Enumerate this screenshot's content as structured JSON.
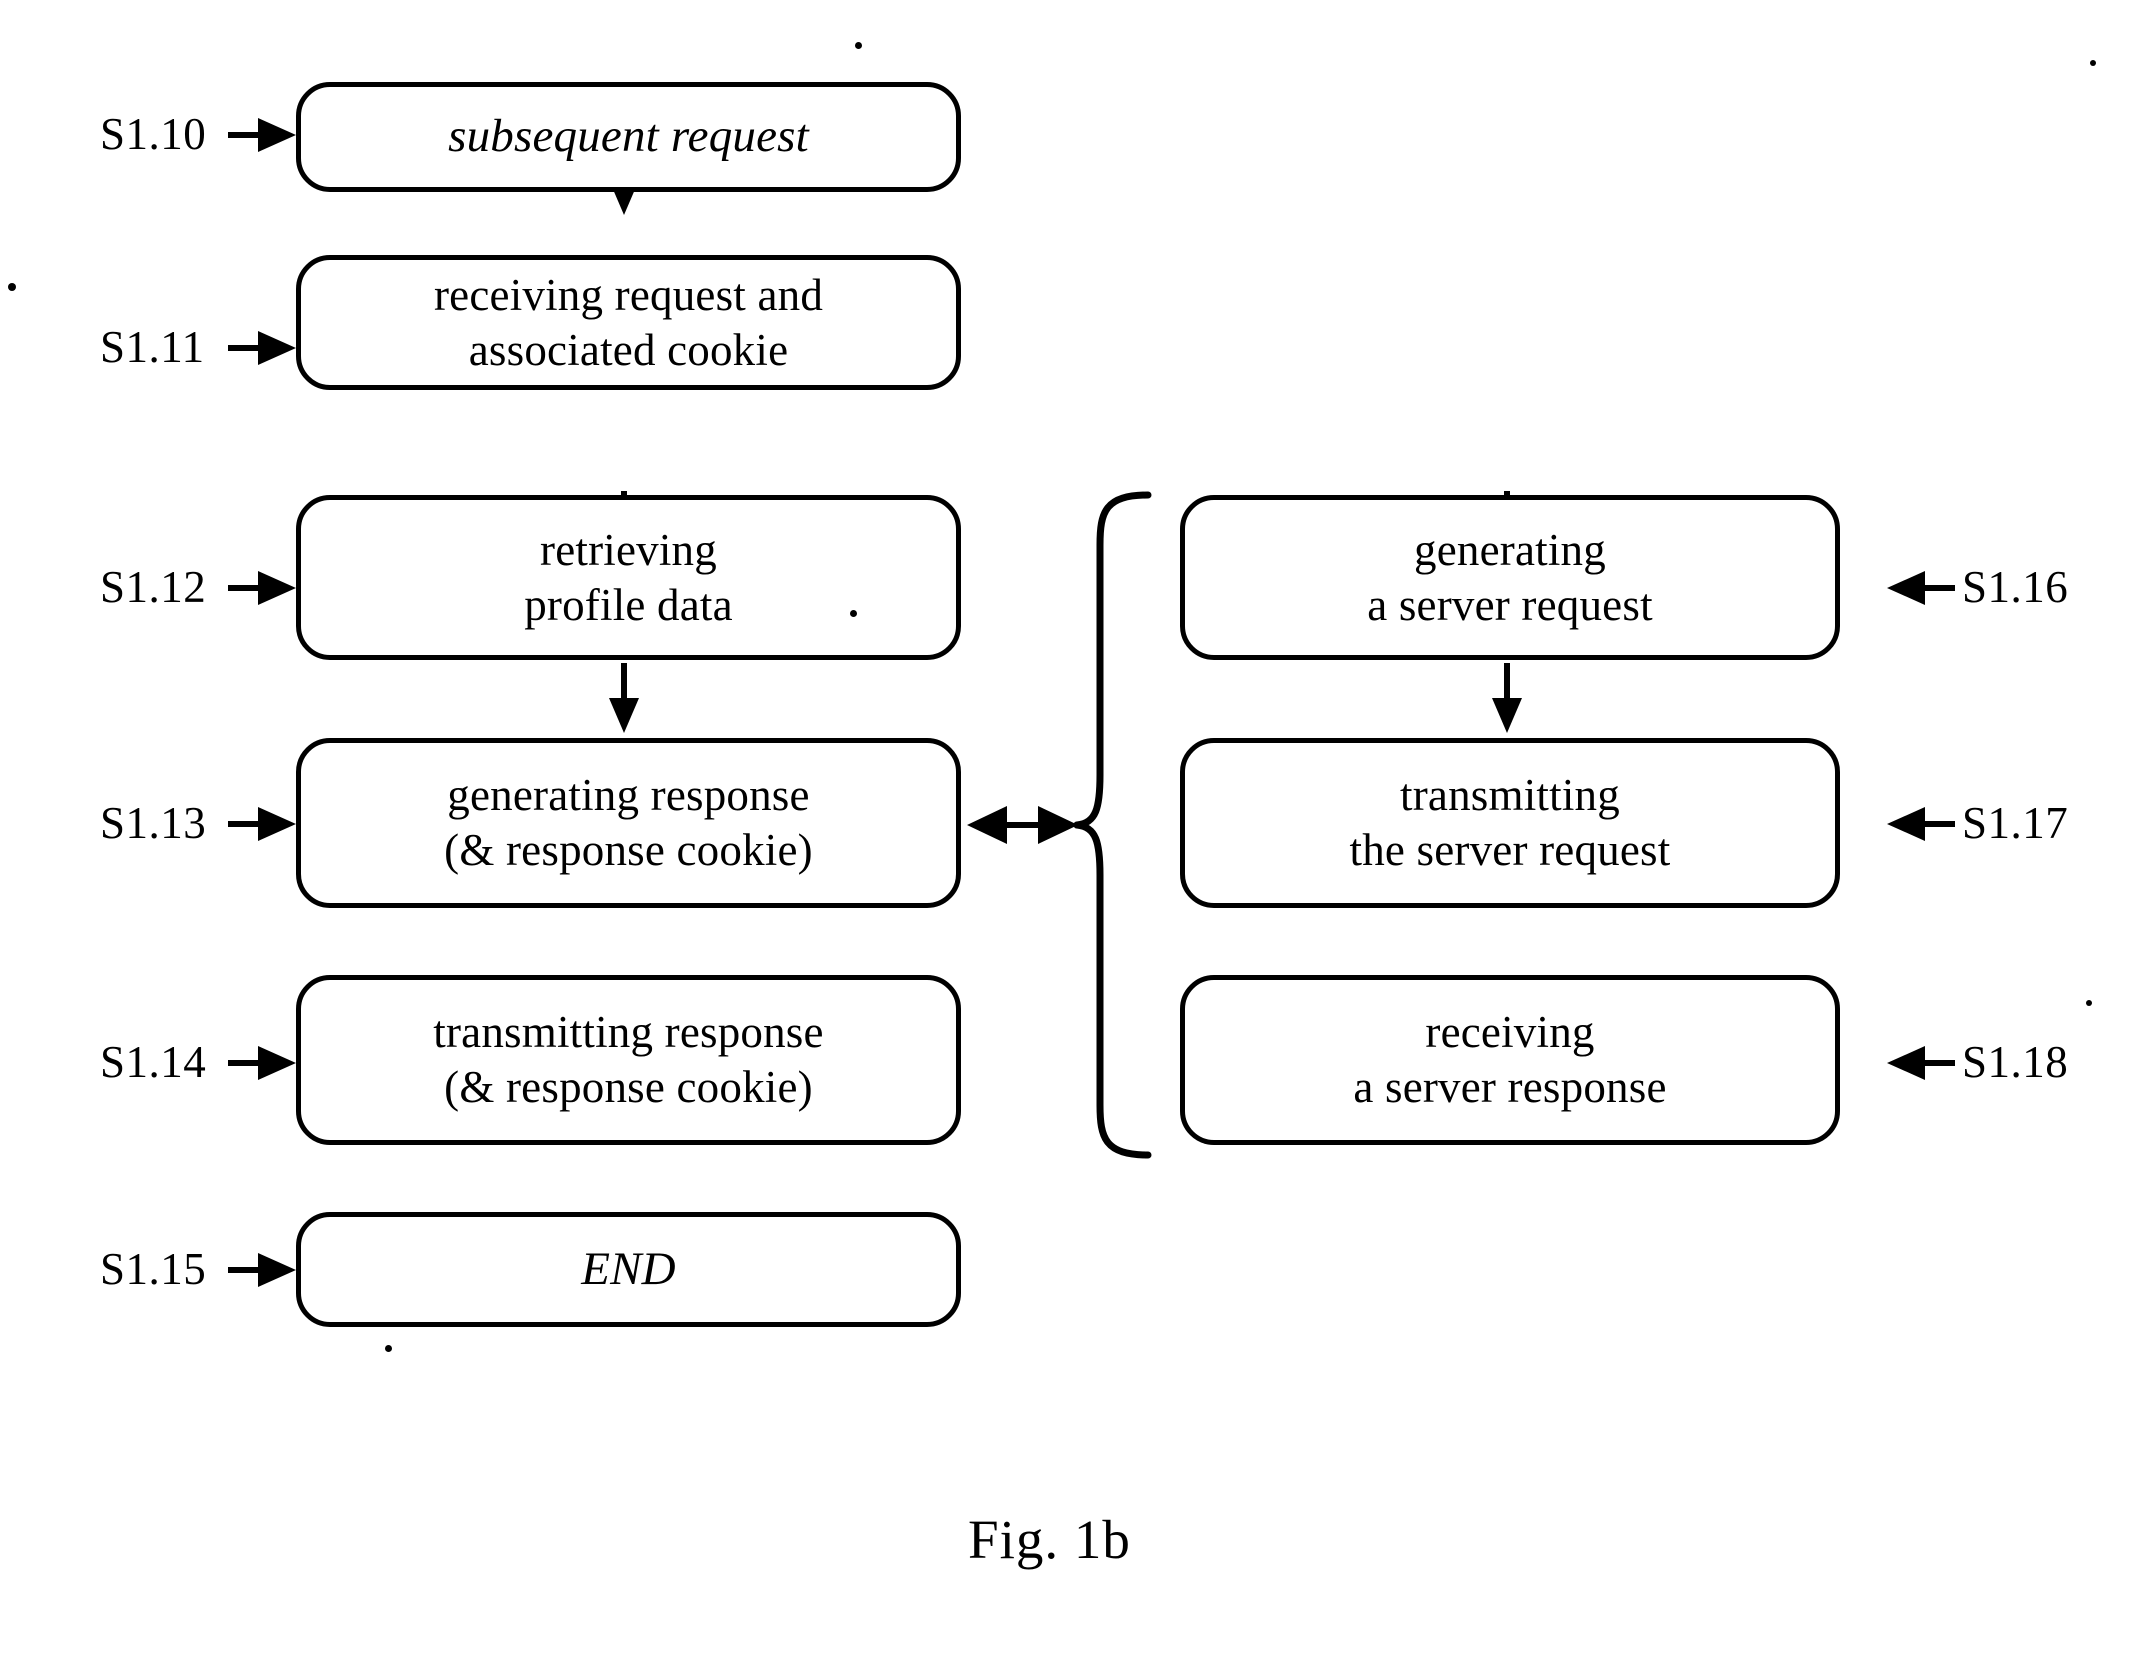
{
  "figure": {
    "caption": "Fig. 1b",
    "type": "patent-flowchart"
  },
  "left_column": {
    "nodes": [
      {
        "step": "S1.10",
        "lines": [
          "subsequent request"
        ],
        "style": "italic"
      },
      {
        "step": "S1.11",
        "lines": [
          "receiving request and",
          "associated cookie"
        ],
        "style": "normal"
      },
      {
        "step": "S1.12",
        "lines": [
          "retrieving",
          "profile data"
        ],
        "style": "normal"
      },
      {
        "step": "S1.13",
        "lines": [
          "generating response",
          "(& response cookie)"
        ],
        "style": "normal"
      },
      {
        "step": "S1.14",
        "lines": [
          "transmitting response",
          "(& response cookie)"
        ],
        "style": "normal"
      },
      {
        "step": "S1.15",
        "lines": [
          "END"
        ],
        "style": "italic"
      }
    ]
  },
  "right_column": {
    "nodes": [
      {
        "step": "S1.16",
        "lines": [
          "generating",
          "a server request"
        ],
        "style": "normal"
      },
      {
        "step": "S1.17",
        "lines": [
          "transmitting",
          "the server request"
        ],
        "style": "normal"
      },
      {
        "step": "S1.18",
        "lines": [
          "receiving",
          "a server response"
        ],
        "style": "normal"
      }
    ]
  },
  "connectors": {
    "vertical_flow_left": "down-arrow",
    "vertical_flow_right": "down-arrow",
    "branch_link": "double-headed-arrow",
    "brace": "left-curly-brace"
  },
  "colors": {
    "stroke": "#000000",
    "background": "#ffffff"
  }
}
